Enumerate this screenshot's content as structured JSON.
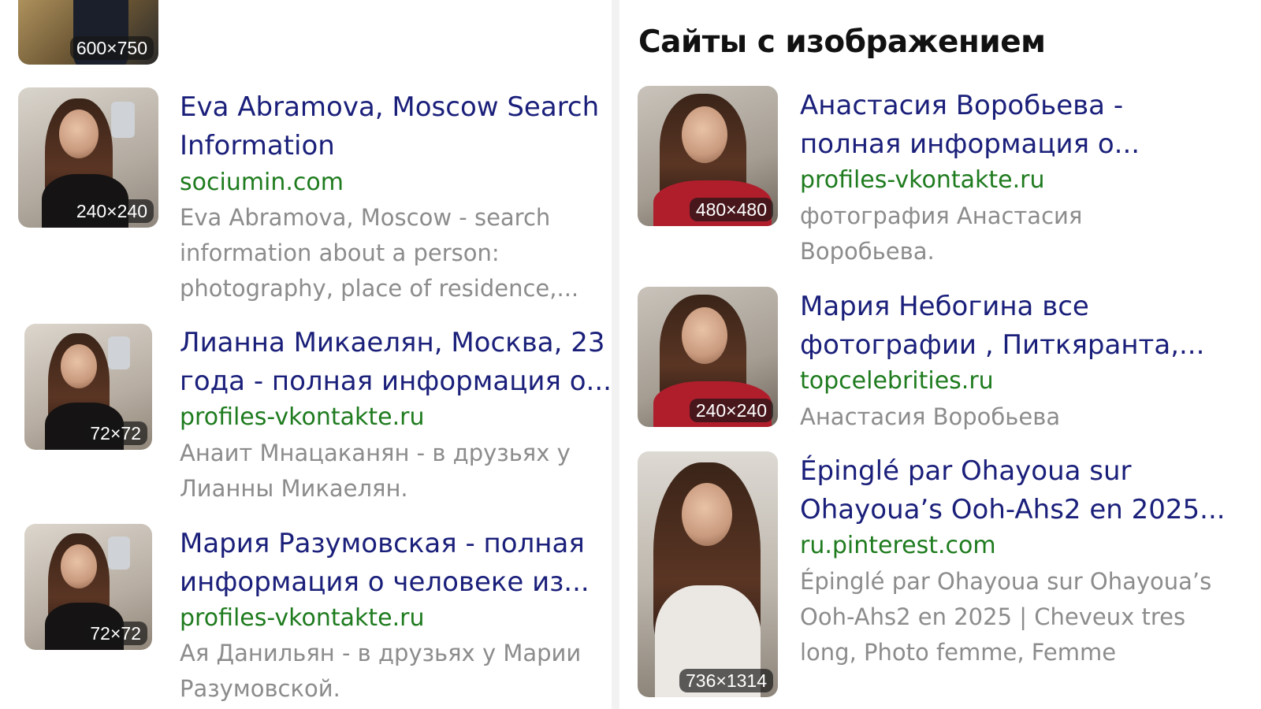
{
  "left": {
    "top_partial": {
      "size": "600×750"
    },
    "results": [
      {
        "size": "240×240",
        "title_lines": [
          "Eva Abramova, Moscow Search",
          "Information"
        ],
        "domain": "sociumin.com",
        "snippet_lines": [
          "Eva Abramova, Moscow - search",
          "information about a person:",
          "photography, place of residence,..."
        ]
      },
      {
        "size": "72×72",
        "title_lines": [
          "Лианна Микаелян, Москва, 23",
          "года - полная информация о..."
        ],
        "domain": "profiles-vkontakte.ru",
        "snippet_lines": [
          "Анаит Мнацаканян - в друзьях у",
          "Лианны Микаелян."
        ]
      },
      {
        "size": "72×72",
        "title_lines": [
          "Мария Разумовская - полная",
          "информация о человеке из..."
        ],
        "domain": "profiles-vkontakte.ru",
        "snippet_lines": [
          "Ая Данильян - в друзьях у Марии",
          "Разумовской."
        ]
      }
    ]
  },
  "right": {
    "section_title": "Сайты с изображением",
    "results": [
      {
        "size": "480×480",
        "title_lines": [
          "Анастасия Воробьева -",
          "полная информация о..."
        ],
        "domain": "profiles-vkontakte.ru",
        "snippet_lines": [
          "фотография Анастасия",
          "Воробьева."
        ]
      },
      {
        "size": "240×240",
        "title_lines": [
          "Мария Небогина все",
          "фотографии , Питкяранта,..."
        ],
        "domain": "topcelebrities.ru",
        "snippet_lines": [
          "Анастасия Воробьева"
        ]
      },
      {
        "size": "736×1314",
        "title_lines": [
          "Épinglé par Ohayoua sur",
          "Ohayoua’s Ooh-Ahs2 en 2025..."
        ],
        "domain": "ru.pinterest.com",
        "snippet_lines": [
          "Épinglé par Ohayoua sur Ohayoua’s",
          "Ooh-Ahs2 en 2025 | Cheveux tres",
          "long, Photo femme, Femme"
        ]
      }
    ]
  },
  "colors": {
    "title": "#1a1f7a",
    "domain": "#1e7b1e",
    "snippet": "#8c8c8c",
    "section_title": "#111111"
  }
}
